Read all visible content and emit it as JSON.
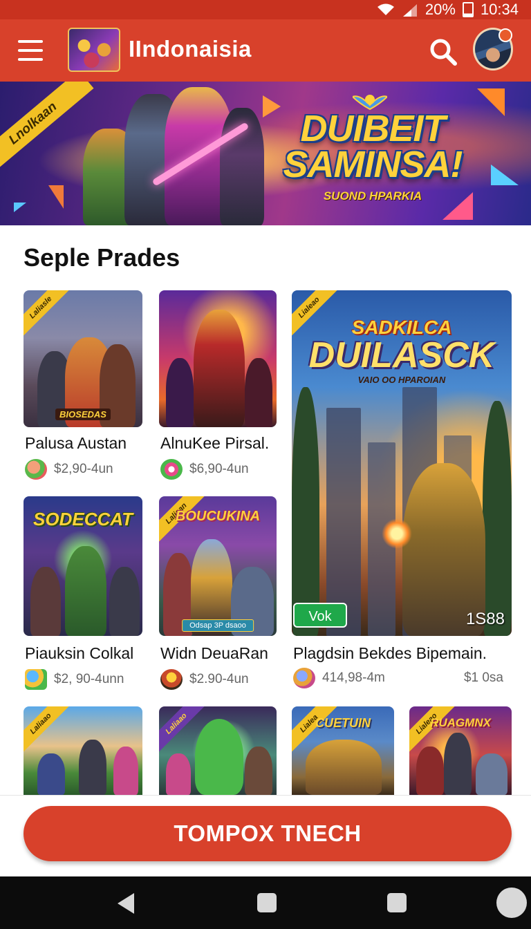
{
  "status_bar": {
    "battery_percent": "20%",
    "time": "10:34"
  },
  "app_bar": {
    "title": "IIndonaisia"
  },
  "hero": {
    "ribbon": "Lnolkaan",
    "title_line1": "DUIBEIT",
    "title_line2": "SAMINSA!",
    "subtitle": "SUOND HPARKIA"
  },
  "section": {
    "title": "Seple Prades"
  },
  "games": [
    {
      "title": "Palusa Austan",
      "price": "$2,90-4un",
      "ribbon": "Laliasle",
      "caption": "BIOSEDAS"
    },
    {
      "title": "AlnuKee Pirsal.",
      "price": "$6,90-4un",
      "ribbon": "",
      "caption": ""
    },
    {
      "title": "Plagdsin Bekdes Bipemain.",
      "price_left": "414,98-4m",
      "price_right": "$1 0sa",
      "ribbon": "Lialeao",
      "caption_line1": "SADKILCA",
      "caption_line2": "DUILASCK",
      "caption_line3": "VAIO OO HPAROIAN",
      "badge": "Vok",
      "number": "1S88"
    },
    {
      "title": "Piauksin Colkal",
      "price": "$2, 90-4unn",
      "ribbon": "",
      "caption": "SODECCAT"
    },
    {
      "title": "Widn DeuaRan",
      "price": "$2.90-4un",
      "ribbon": "Laliaan",
      "caption": "BOUCUKINA",
      "caption_bottom": "Odsap 3P dsaoo"
    },
    {
      "ribbon": "Laliaao"
    },
    {
      "ribbon": "Laliaao"
    },
    {
      "ribbon": "Lialea",
      "caption": "CUETUIN"
    },
    {
      "ribbon": "Lialeao",
      "caption": "RUAGMNX"
    }
  ]
}
